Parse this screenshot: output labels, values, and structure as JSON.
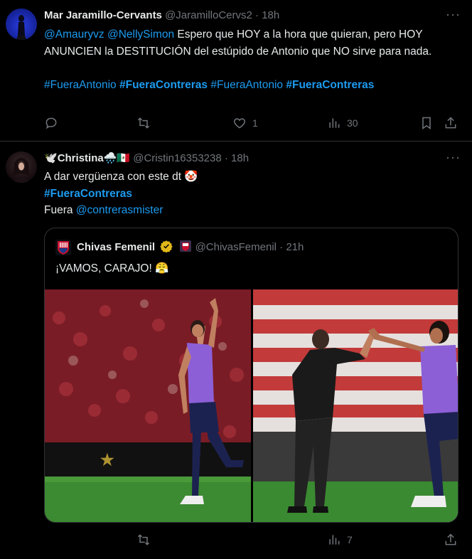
{
  "tweets": [
    {
      "name": "Mar Jaramillo-Cervants",
      "handle": "@JaramilloCervs2",
      "dot": "·",
      "time": "18h",
      "more": "···",
      "mention1": "@Amauryvz",
      "mention2": "@NellySimon",
      "body": " Espero que HOY a la hora que quieran, pero HOY ANUNCIEN la DESTITUCIÓN del estúpido de Antonio que NO sirve para nada.",
      "hashtag1": "#FueraAntonio",
      "hashtag2": "#FueraContreras",
      "hashtag3": "#FueraAntonio",
      "hashtag4": "#FueraContreras",
      "likes": "1",
      "views": "30"
    },
    {
      "name_prefix": "🕊️",
      "name": "Christina",
      "name_suffix": "🌧️🇲🇽",
      "handle": "@Cristin16353238",
      "dot": "·",
      "time": "18h",
      "more": "···",
      "line1": "A dar vergüenza con este dt 🤡",
      "hashtag": "#FueraContreras",
      "line3_prefix": "Fuera ",
      "mention": "@contrerasmister",
      "views": "7",
      "quote": {
        "name": "Chivas Femenil",
        "handle": "@ChivasFemenil",
        "dot": "·",
        "time": "21h",
        "text": "¡VAMOS, CARAJO! 😤"
      }
    }
  ],
  "colors": {
    "background": "#000000",
    "text": "#e7e9ea",
    "muted": "#71767b",
    "link": "#1d9bf0",
    "border": "#2f3336",
    "jersey": "#8c5fd6",
    "pitch": "#2f7d2a"
  }
}
